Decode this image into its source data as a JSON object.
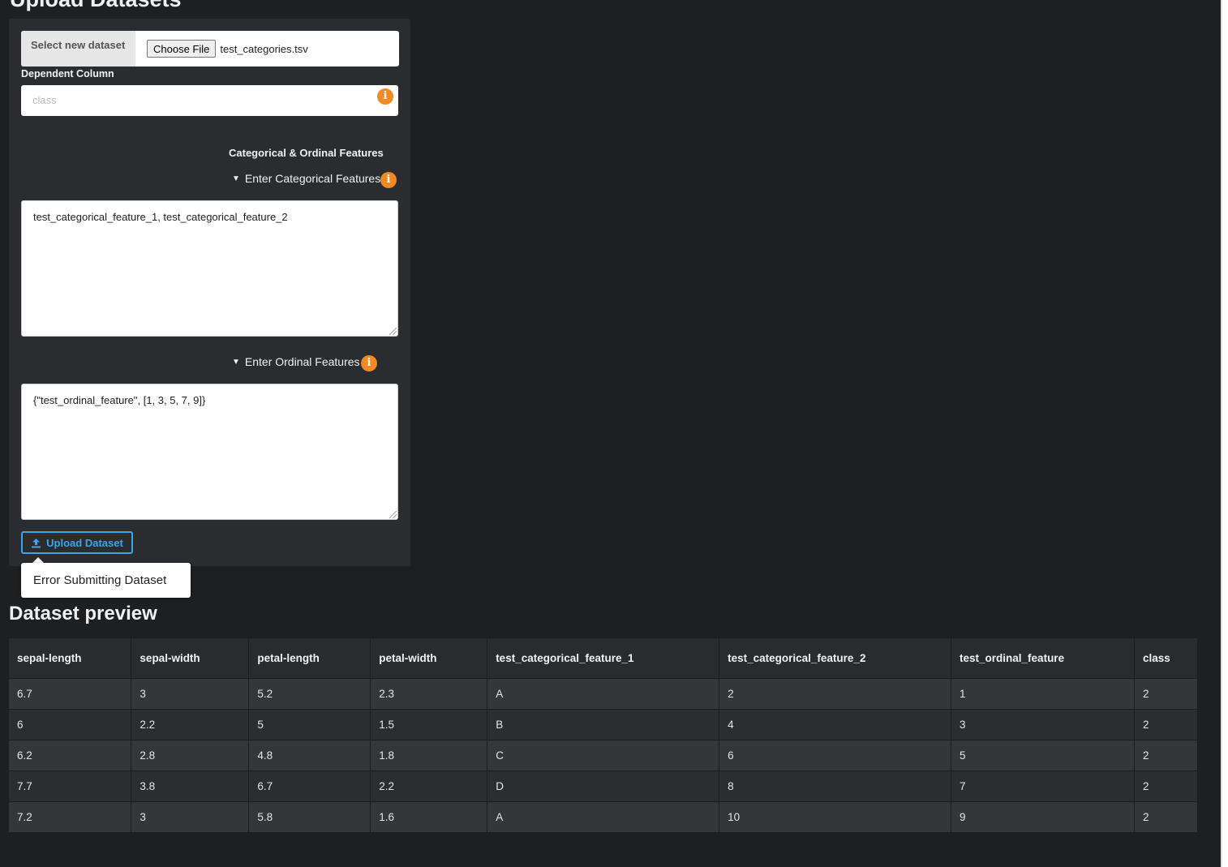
{
  "page": {
    "title": "Upload Datasets"
  },
  "form": {
    "file_addon_label": "Select new dataset",
    "choose_file_label": "Choose File",
    "file_name": "test_categories.tsv",
    "dependent_column_label": "Dependent Column",
    "dependent_column_placeholder": "class",
    "features_section_title": "Categorical & Ordinal Features",
    "categorical_toggle_label": "Enter Categorical Features",
    "categorical_value": "test_categorical_feature_1, test_categorical_feature_2",
    "ordinal_toggle_label": "Enter Ordinal Features",
    "ordinal_value": "{\"test_ordinal_feature\", [1, 3, 5, 7, 9]}",
    "upload_button_label": "Upload Dataset",
    "error_tooltip": "Error Submitting Dataset",
    "info_glyph": "i"
  },
  "preview": {
    "title": "Dataset preview",
    "columns": [
      "sepal-length",
      "sepal-width",
      "petal-length",
      "petal-width",
      "test_categorical_feature_1",
      "test_categorical_feature_2",
      "test_ordinal_feature",
      "class"
    ],
    "rows": [
      [
        "6.7",
        "3",
        "5.2",
        "2.3",
        "A",
        "2",
        "1",
        "2"
      ],
      [
        "6",
        "2.2",
        "5",
        "1.5",
        "B",
        "4",
        "3",
        "2"
      ],
      [
        "6.2",
        "2.8",
        "4.8",
        "1.8",
        "C",
        "6",
        "5",
        "2"
      ],
      [
        "7.7",
        "3.8",
        "6.7",
        "2.2",
        "D",
        "8",
        "7",
        "2"
      ],
      [
        "7.2",
        "3",
        "5.8",
        "1.6",
        "A",
        "10",
        "9",
        "2"
      ]
    ]
  },
  "colors": {
    "background": "#1e1f21",
    "panel": "#2b2c2f",
    "accent": "#3ba7e6",
    "info": "#f08a24"
  }
}
